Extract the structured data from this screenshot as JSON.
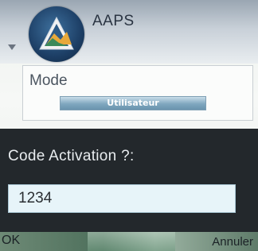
{
  "app": {
    "title": "AAPS"
  },
  "mode_panel": {
    "label": "Mode",
    "selected": "Utilisateur"
  },
  "dialog": {
    "title": "Code Activation ?:",
    "input_value": "1234"
  },
  "softkeys": {
    "left": "OK",
    "right": "Annuler"
  },
  "colors": {
    "dialog_bg": "#23282c",
    "input_bg": "#e7f4f9",
    "mode_highlight": "#7fa7bf",
    "logo": "#1d3f66"
  }
}
